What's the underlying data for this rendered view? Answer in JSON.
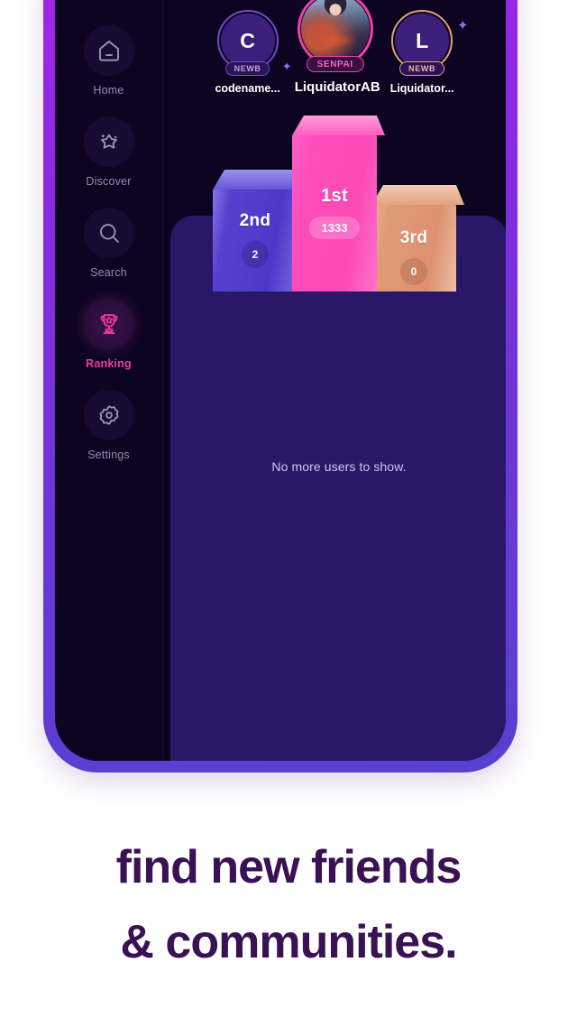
{
  "app": {
    "screen_title": "Ranking"
  },
  "sidebar": {
    "items": [
      {
        "label": "Home",
        "icon": "home-icon",
        "active": false
      },
      {
        "label": "Discover",
        "icon": "star-icon",
        "active": false
      },
      {
        "label": "Search",
        "icon": "search-icon",
        "active": false
      },
      {
        "label": "Ranking",
        "icon": "trophy-icon",
        "active": true
      },
      {
        "label": "Settings",
        "icon": "gear-icon",
        "active": false
      }
    ],
    "active_color": "#f0389f",
    "inactive_color": "#948bb0"
  },
  "leaderboard": {
    "top_users": [
      {
        "initial": "C",
        "badge": "NEWB",
        "name": "codename...",
        "place": "2nd",
        "ring_color": "#6f4ad0"
      },
      {
        "initial": "",
        "badge": "SENPAI",
        "name": "LiquidatorAB",
        "place": "1st",
        "ring_color": "#ee3fae"
      },
      {
        "initial": "L",
        "badge": "NEWB",
        "name": "Liquidator...",
        "place": "3rd",
        "ring_color": "#e0a07d"
      }
    ],
    "podium": [
      {
        "rank_label": "2nd",
        "score": "2",
        "color": "#5840cf"
      },
      {
        "rank_label": "1st",
        "score": "1333",
        "color": "#fb49b8"
      },
      {
        "rank_label": "3rd",
        "score": "0",
        "color": "#dd9170"
      }
    ],
    "empty_message": "No more users to show."
  },
  "promo": {
    "line1": "find new friends",
    "line2": "& communities.",
    "text_color": "#3a1155"
  }
}
